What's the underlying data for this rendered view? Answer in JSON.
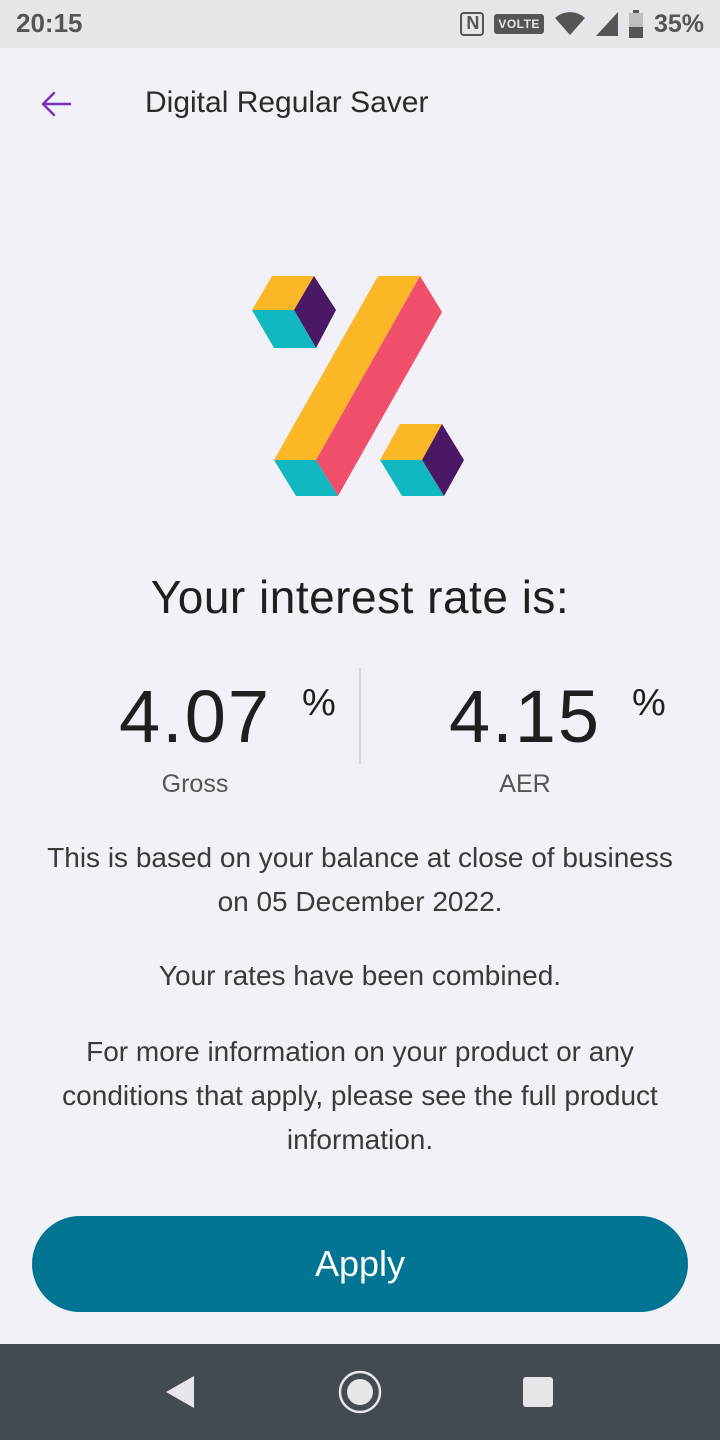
{
  "status_bar": {
    "time": "20:15",
    "volte": "VOLTE",
    "battery": "35%",
    "icons": [
      "nfc-icon",
      "wifi-icon",
      "signal-icon",
      "battery-icon"
    ]
  },
  "header": {
    "title": "Digital Regular Saver",
    "back_icon": "arrow-left-icon"
  },
  "headline": "Your interest rate is:",
  "rates": [
    {
      "value": "4.07",
      "unit": "%",
      "label": "Gross"
    },
    {
      "value": "4.15",
      "unit": "%",
      "label": "AER"
    }
  ],
  "info": {
    "balance_note": "This is based on your balance at close of business on 05 December 2022.",
    "combined_note": "Your rates have been combined.",
    "more_info": "For more information on your product or any conditions that apply, please see the full product information."
  },
  "apply_button": {
    "label": "Apply"
  },
  "colors": {
    "accent": "#027594",
    "back_arrow": "#7b2fbf",
    "background": "#f1f1f7",
    "logo_yellow": "#fbb726",
    "logo_pink": "#ef4f6b",
    "logo_teal": "#12b8bf",
    "logo_purple": "#4a1865"
  },
  "nav_bar": {
    "icons": [
      "nav-back-icon",
      "nav-home-icon",
      "nav-recents-icon"
    ]
  }
}
